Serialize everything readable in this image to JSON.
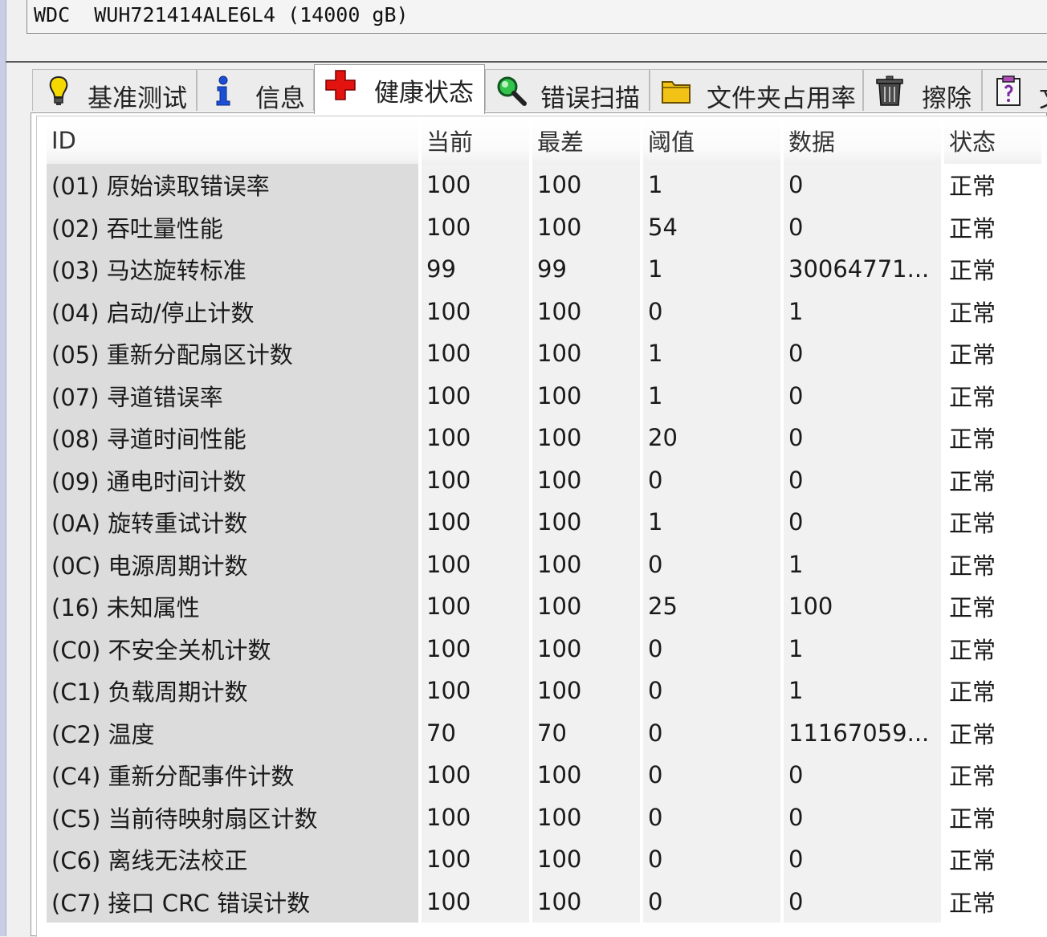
{
  "drive": {
    "label": "WDC  WUH721414ALE6L4 (14000 gB)"
  },
  "tabs": [
    {
      "label": "基准测试",
      "icon": "bulb-icon"
    },
    {
      "label": "信息",
      "icon": "info-icon"
    },
    {
      "label": "健康状态",
      "icon": "health-cross-icon",
      "active": true
    },
    {
      "label": "错误扫描",
      "icon": "magnifier-icon"
    },
    {
      "label": "文件夹占用率",
      "icon": "folder-icon"
    },
    {
      "label": "擦除",
      "icon": "trash-icon"
    },
    {
      "label": "文",
      "icon": "clipboard-icon"
    }
  ],
  "table": {
    "headers": [
      "ID",
      "当前",
      "最差",
      "阈值",
      "数据",
      "状态"
    ],
    "rows": [
      [
        "(01) 原始读取错误率",
        "100",
        "100",
        "1",
        "0",
        "正常"
      ],
      [
        "(02) 吞吐量性能",
        "100",
        "100",
        "54",
        "0",
        "正常"
      ],
      [
        "(03) 马达旋转标准",
        "99",
        "99",
        "1",
        "30064771...",
        "正常"
      ],
      [
        "(04) 启动/停止计数",
        "100",
        "100",
        "0",
        "1",
        "正常"
      ],
      [
        "(05) 重新分配扇区计数",
        "100",
        "100",
        "1",
        "0",
        "正常"
      ],
      [
        "(07) 寻道错误率",
        "100",
        "100",
        "1",
        "0",
        "正常"
      ],
      [
        "(08) 寻道时间性能",
        "100",
        "100",
        "20",
        "0",
        "正常"
      ],
      [
        "(09) 通电时间计数",
        "100",
        "100",
        "0",
        "0",
        "正常"
      ],
      [
        "(0A) 旋转重试计数",
        "100",
        "100",
        "1",
        "0",
        "正常"
      ],
      [
        "(0C) 电源周期计数",
        "100",
        "100",
        "0",
        "1",
        "正常"
      ],
      [
        "(16) 未知属性",
        "100",
        "100",
        "25",
        "100",
        "正常"
      ],
      [
        "(C0) 不安全关机计数",
        "100",
        "100",
        "0",
        "1",
        "正常"
      ],
      [
        "(C1) 负载周期计数",
        "100",
        "100",
        "0",
        "1",
        "正常"
      ],
      [
        "(C2) 温度",
        "70",
        "70",
        "0",
        "11167059...",
        "正常"
      ],
      [
        "(C4) 重新分配事件计数",
        "100",
        "100",
        "0",
        "0",
        "正常"
      ],
      [
        "(C5) 当前待映射扇区计数",
        "100",
        "100",
        "0",
        "0",
        "正常"
      ],
      [
        "(C6) 离线无法校正",
        "100",
        "100",
        "0",
        "0",
        "正常"
      ],
      [
        "(C7) 接口 CRC 错误计数",
        "100",
        "100",
        "0",
        "0",
        "正常"
      ]
    ]
  }
}
